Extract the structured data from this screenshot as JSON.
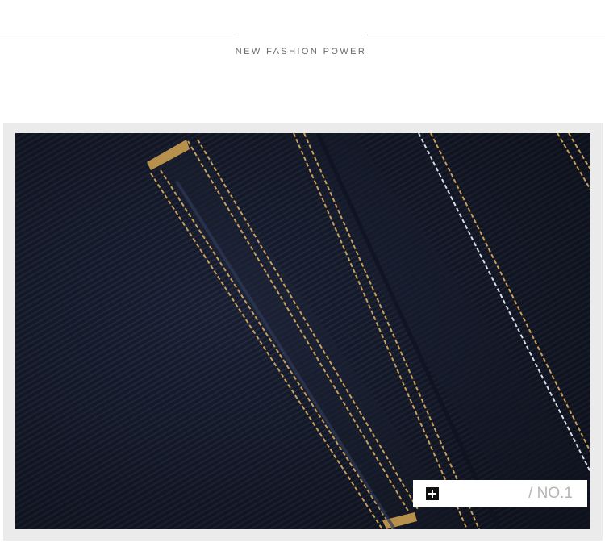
{
  "header": {
    "tagline": "NEW FASHION POWER"
  },
  "photo": {
    "subject": "dark-indigo-denim-pocket-closeup",
    "colors": {
      "denim_dark": "#141a2a",
      "denim_mid": "#232b40",
      "stitch_gold": "#c9a05a",
      "stitch_white": "#d9dde6"
    }
  },
  "caption": {
    "icon": "plus-icon",
    "text": "/ NO.1"
  }
}
